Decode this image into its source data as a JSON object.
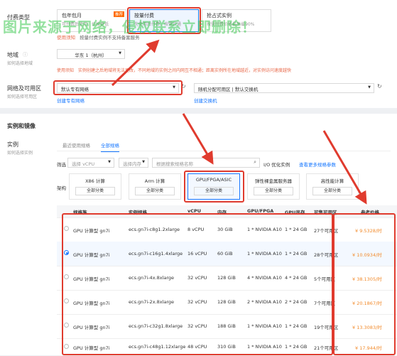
{
  "watermark": "图片来源于网络，侵权联系立即删除！",
  "billing": {
    "label": "付费类型",
    "options": [
      {
        "title": "包年包月",
        "desc": "可付费后使用，价格更低",
        "badge": "推荐"
      },
      {
        "title": "按量付费",
        "desc": "先使用后付费，按需开通"
      },
      {
        "title": "抢占式实例",
        "desc": "按需付费价格最高省90%"
      }
    ],
    "notice_tag": "使用须知",
    "notice": "按量付费实例不支持备案服务"
  },
  "region": {
    "label": "地域",
    "help": "如何选择地域",
    "value": "华东 1（杭州）",
    "notice_tag": "使用须知",
    "notice": "实例创建之后地域将无法更改，不同地域的实例之间内网互不相通；距离实例所在地域越近，对实例访问速度越快"
  },
  "network": {
    "label": "网络及可用区",
    "help": "如何选择可用区",
    "vpc_value": "默认专有网络",
    "vpc_link": "创建专有网络",
    "zone_value": "随机分配可用区 | 默认交换机",
    "zone_link": "创建交换机"
  },
  "section_title": "实例和镜像",
  "instance": {
    "label": "实例",
    "help": "如何选择实例",
    "tabs": [
      "最近使用规格",
      "全部规格"
    ],
    "filter_label": "筛选",
    "vcpu_placeholder": "选择 vCPU",
    "mem_placeholder": "选择内存",
    "search_placeholder": "根据搜索规格名称",
    "io_label": "I/O 优化实例",
    "more_params": "查看更多规格参数",
    "arch_label": "架构",
    "archs": [
      {
        "name": "X86 计算",
        "sel": "全部分类"
      },
      {
        "name": "Arm 计算",
        "sel": "全部分类"
      },
      {
        "name": "GPU/FPGA/ASIC",
        "sel": "全部分类"
      },
      {
        "name": "弹性裸金属服务器",
        "sel": "全部分类"
      },
      {
        "name": "高性能计算",
        "sel": "全部分类"
      }
    ],
    "columns": [
      "规格族",
      "实例规格",
      "vCPU",
      "内存",
      "GPU/FPGA",
      "GPU显存",
      "可售可用区",
      "参考价格"
    ],
    "rows": [
      {
        "family": "GPU 计算型 gn7i",
        "spec": "ecs.gn7i-c8g1.2xlarge",
        "vcpu": "8 vCPU",
        "mem": "30 GiB",
        "gpu": "1 * NVIDIA A10",
        "gmem": "1 * 24 GB",
        "zones": "27个可用区",
        "price": "¥ 9.5328/时"
      },
      {
        "family": "GPU 计算型 gn7i",
        "spec": "ecs.gn7i-c16g1.4xlarge",
        "vcpu": "16 vCPU",
        "mem": "60 GiB",
        "gpu": "1 * NVIDIA A10",
        "gmem": "1 * 24 GB",
        "zones": "28个可用区",
        "price": "¥ 10.0934/时"
      },
      {
        "family": "GPU 计算型 gn7i",
        "spec": "ecs.gn7i-4x.8xlarge",
        "vcpu": "32 vCPU",
        "mem": "128 GiB",
        "gpu": "4 * NVIDIA A10",
        "gmem": "4 * 24 GB",
        "zones": "5个可用区",
        "price": "¥ 38.1305/时"
      },
      {
        "family": "GPU 计算型 gn7i",
        "spec": "ecs.gn7i-2x.8xlarge",
        "vcpu": "32 vCPU",
        "mem": "128 GiB",
        "gpu": "2 * NVIDIA A10",
        "gmem": "2 * 24 GB",
        "zones": "7个可用区",
        "price": "¥ 20.1867/时"
      },
      {
        "family": "GPU 计算型 gn7i",
        "spec": "ecs.gn7i-c32g1.8xlarge",
        "vcpu": "32 vCPU",
        "mem": "188 GiB",
        "gpu": "1 * NVIDIA A10",
        "gmem": "1 * 24 GB",
        "zones": "19个可用区",
        "price": "¥ 13.3083/时"
      },
      {
        "family": "GPU 计算型 gn7i",
        "spec": "ecs.gn7i-c48g1.12xlarge",
        "vcpu": "48 vCPU",
        "mem": "310 GiB",
        "gpu": "1 * NVIDIA A10",
        "gmem": "1 * 24 GB",
        "zones": "21个可用区",
        "price": "¥ 17.944/时"
      }
    ]
  },
  "colors": {
    "accent": "#1677ff",
    "annotation_red": "#e03b2e",
    "price": "#f28b2c",
    "watermark": "#3cc850"
  }
}
